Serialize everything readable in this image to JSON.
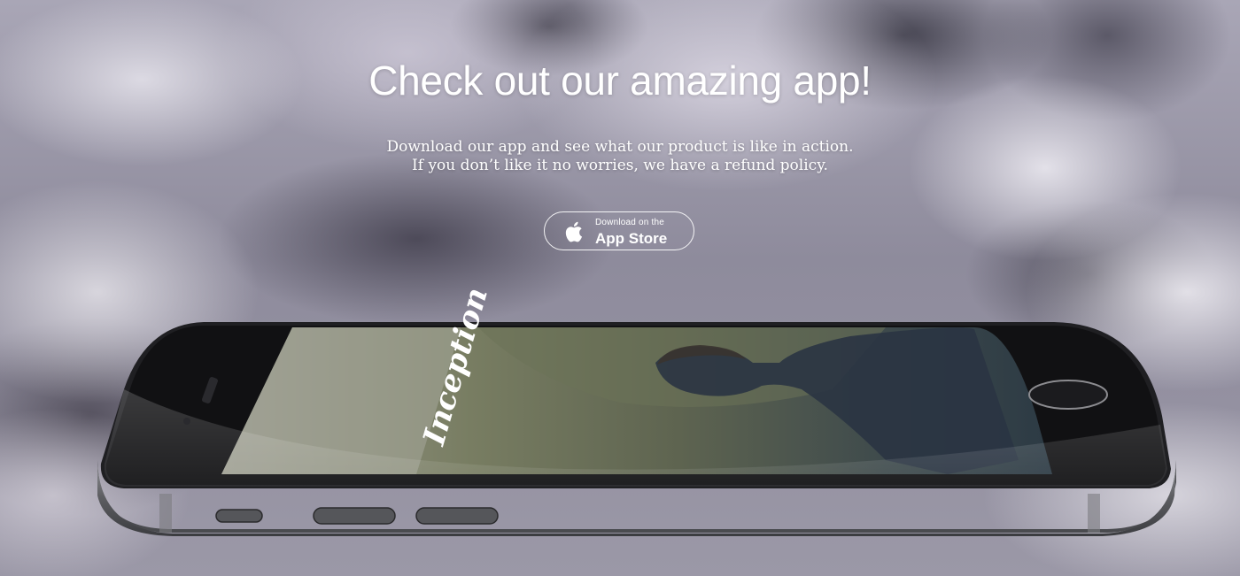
{
  "hero": {
    "title": "Check out our amazing app!",
    "subtitle_line1": "Download our app and see what our product is like in action.",
    "subtitle_line2": "If you don’t like it no worries, we have a refund policy."
  },
  "app_store_button": {
    "small_label": "Download on the",
    "big_label": "App Store",
    "icon": "apple-icon"
  },
  "phone_screen": {
    "app_title": "Inception"
  },
  "colors": {
    "text": "#ffffff",
    "phone_body": "#2b2b2e",
    "phone_frame": "#6d6e72"
  }
}
